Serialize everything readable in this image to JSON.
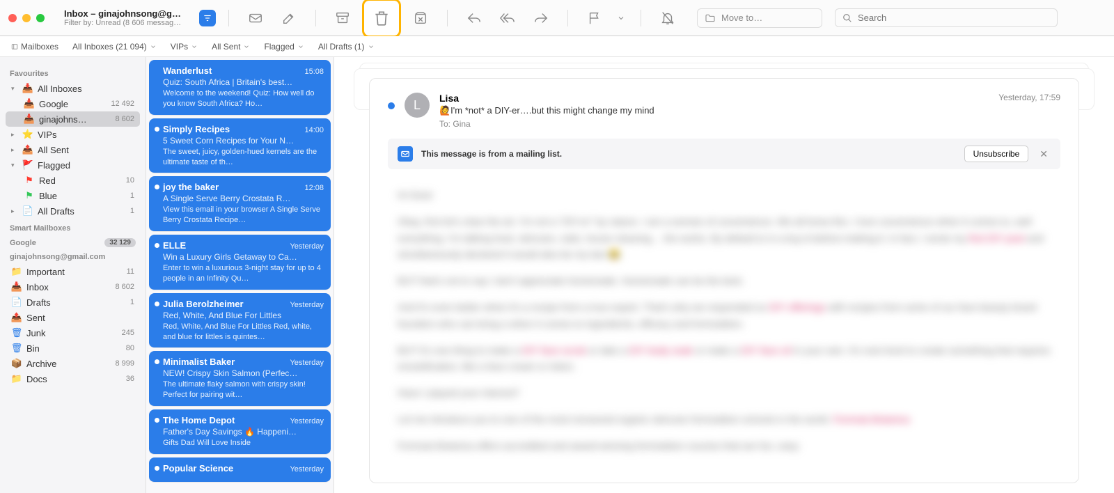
{
  "window": {
    "title": "Inbox – ginajohnsong@g…",
    "subtitle": "Filter by: Unread (8 606 messag…"
  },
  "toolbar": {
    "move_to_label": "Move to…",
    "search_placeholder": "Search"
  },
  "filter_bar": {
    "mailboxes": "Mailboxes",
    "all_inboxes": "All Inboxes (21 094)",
    "vips": "VIPs",
    "all_sent": "All Sent",
    "flagged": "Flagged",
    "all_drafts": "All Drafts (1)"
  },
  "sidebar": {
    "favourites_label": "Favourites",
    "all_inboxes": {
      "label": "All Inboxes"
    },
    "google": {
      "label": "Google",
      "count": "12 492"
    },
    "gina_account": {
      "label": "ginajohns…",
      "count": "8 602"
    },
    "vips": {
      "label": "VIPs"
    },
    "all_sent": {
      "label": "All Sent"
    },
    "flagged": {
      "label": "Flagged"
    },
    "red": {
      "label": "Red",
      "count": "10"
    },
    "blue": {
      "label": "Blue",
      "count": "1"
    },
    "all_drafts": {
      "label": "All Drafts",
      "count": "1"
    },
    "smart_label": "Smart Mailboxes",
    "google_section": {
      "label": "Google",
      "count": "32 129"
    },
    "account_label": "ginajohnsong@gmail.com",
    "important": {
      "label": "Important",
      "count": "11"
    },
    "inbox": {
      "label": "Inbox",
      "count": "8 602"
    },
    "drafts": {
      "label": "Drafts",
      "count": "1"
    },
    "sent": {
      "label": "Sent"
    },
    "junk": {
      "label": "Junk",
      "count": "245"
    },
    "bin": {
      "label": "Bin",
      "count": "80"
    },
    "archive": {
      "label": "Archive",
      "count": "8 999"
    },
    "docs": {
      "label": "Docs",
      "count": "36"
    }
  },
  "messages": [
    {
      "sender": "Wanderlust",
      "time": "15:08",
      "subject": "Quiz: South Africa | Britain's best…",
      "preview": "Welcome to the weekend! Quiz: How well do you know South Africa? Ho…",
      "unread": false,
      "selected": true
    },
    {
      "sender": "Simply Recipes",
      "time": "14:00",
      "subject": "5 Sweet Corn Recipes for Your N…",
      "preview": "The sweet, juicy, golden-hued kernels are the ultimate taste of th…",
      "unread": true,
      "selected": true
    },
    {
      "sender": "joy the baker",
      "time": "12:08",
      "subject": "A Single Serve Berry Crostata R…",
      "preview": "View this email in your browser A Single Serve Berry Crostata Recipe…",
      "unread": true,
      "selected": true
    },
    {
      "sender": "ELLE",
      "time": "Yesterday",
      "subject": "Win a Luxury Girls Getaway to Ca…",
      "preview": "Enter to win a luxurious 3-night stay for up to 4 people in an Infinity Qu…",
      "unread": true,
      "selected": true
    },
    {
      "sender": "Julia Berolzheimer",
      "time": "Yesterday",
      "subject": "Red, White, And Blue For Littles",
      "preview": "Red, White, And Blue For Littles Red, white, and blue for littles is quintes…",
      "unread": true,
      "selected": true
    },
    {
      "sender": "Minimalist Baker",
      "time": "Yesterday",
      "subject": "NEW! Crispy Skin Salmon (Perfec…",
      "preview": "The ultimate flaky salmon with crispy skin! Perfect for pairing wit…",
      "unread": true,
      "selected": true
    },
    {
      "sender": "The Home Depot",
      "time": "Yesterday",
      "subject": "Father's Day Savings 🔥 Happeni…",
      "preview": "Gifts Dad Will Love Inside",
      "unread": true,
      "selected": true
    },
    {
      "sender": "Popular Science",
      "time": "Yesterday",
      "subject": "",
      "preview": "",
      "unread": true,
      "selected": true
    }
  ],
  "reader": {
    "from": "Lisa",
    "avatar_initial": "L",
    "subject": "🙋I'm *not* a DIY-er….but this might change my mind",
    "to_label": "To:",
    "to_value": "Gina",
    "date": "Yesterday, 17:59",
    "banner_text": "This message is from a mailing list.",
    "unsubscribe": "Unsubscribe",
    "greeting": "Hi Gina!",
    "body_p1": "Okay, first let's clear the air: I'm not a \"DIY-er\" by nature. I am a woman of convenience. We all know this. I love convenience when it comes to, well everything. I'm talking food, skincare, nails, house cleaning… the works. By default to in a buy-it-before-making-it. In fact, I wrote my",
    "body_link1": "first DIY post",
    "body_p1b": "and simultaneously declared it would also be my last 😂.",
    "body_p2": "BUT that's not to say I don't appreciate homemade. Homemade can be the best.",
    "body_p3": "And it's even better when it's a recipe from a true expert. That's why we responded so",
    "body_link2": "DIY offerings",
    "body_p3b": "with recipes from some of our fave beauty brand founders who can bring a when it comes to ingredients, efficacy and formulation.",
    "body_p4a": "BUT it's one thing to make a",
    "body_link3": "DIY face scrub",
    "body_p4b": "or take a",
    "body_link4": "DIY body soak",
    "body_p4c": "or make a",
    "body_link5": "DIY face oil",
    "body_p4d": "in your own. It's next level to create something that requires emulsification, like a face cream or lotion.",
    "body_p5": "Have I piqued your interest?",
    "body_p6": "Let me introduce you to one of the most renowned organic skincare formulation schools in the world.",
    "body_link6": "Formula Botanica",
    "body_p7": "Formula Botanica offers accredited and award-winning formulation courses that are fun, easy"
  }
}
